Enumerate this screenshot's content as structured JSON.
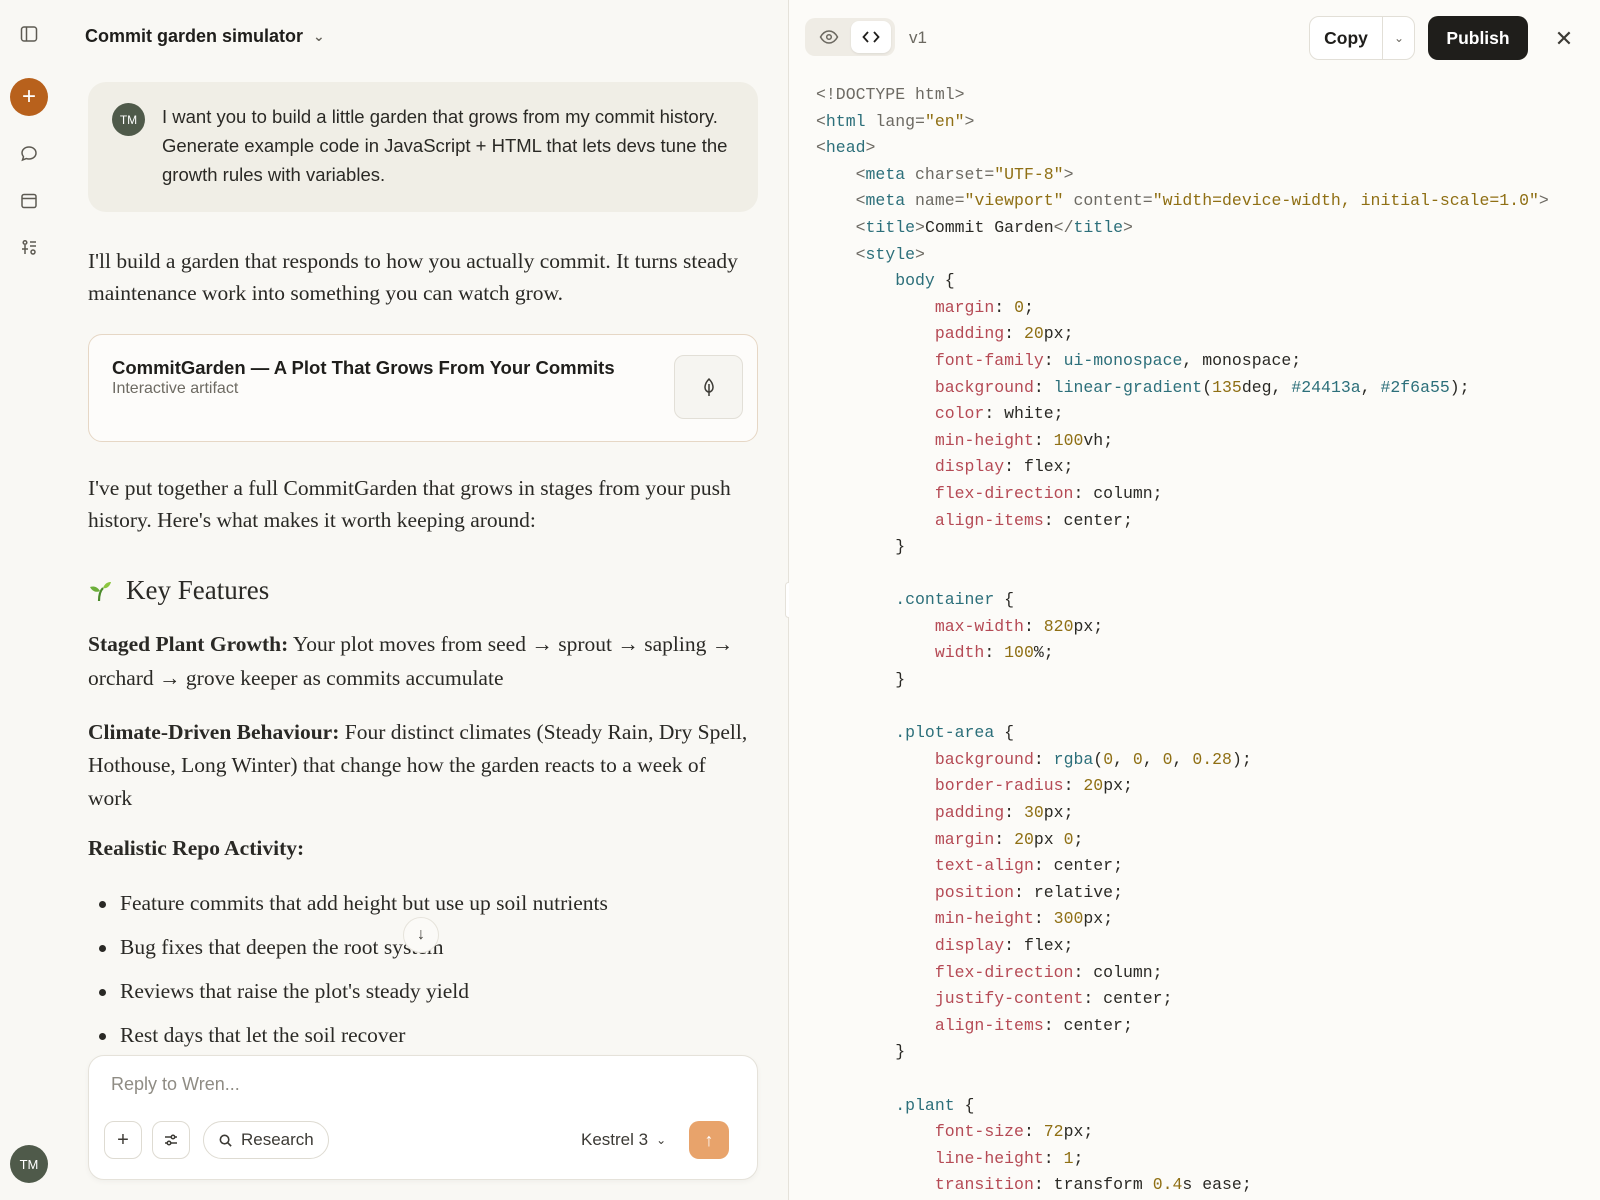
{
  "sidebar": {
    "avatar_initials": "TM",
    "new_chat_icon": "plus-icon",
    "items": [
      {
        "name": "sidebar-toggle-icon"
      },
      {
        "name": "chats-icon"
      },
      {
        "name": "projects-icon"
      },
      {
        "name": "artifacts-icon"
      }
    ]
  },
  "chat": {
    "title": "Commit garden simulator",
    "user_message": {
      "avatar": "TM",
      "text": "I want you to build a little garden that grows from my commit history. Generate example code in JavaScript + HTML that lets devs tune the growth rules with variables."
    },
    "intro": "I'll build a garden that responds to how you actually commit. It turns steady maintenance work into something you can watch grow.",
    "artifact": {
      "title": "CommitGarden — A Plot That Grows From Your Commits",
      "subtitle": "Interactive artifact"
    },
    "paragraph2": "I've put together a full CommitGarden that grows in stages from your push history. Here's what makes it worth keeping around:",
    "features_heading": "Key Features",
    "feature1": {
      "label": "Staged Plant Growth:",
      "text": " Your plot moves from seed → sprout → sapling → orchard → grove keeper as commits accumulate"
    },
    "feature2": {
      "label": "Climate-Driven Behaviour:",
      "text": " Four distinct climates (Steady Rain, Dry Spell, Hothouse, Long Winter) that change how the garden reacts to a week of work"
    },
    "feature3_label": "Realistic Repo Activity:",
    "bullets": [
      "Feature commits that add height but use up soil nutrients",
      "Bug fixes that deepen the root system",
      "Reviews that raise the plot's steady yield",
      "Rest days that let the soil recover"
    ]
  },
  "composer": {
    "placeholder": "Reply to Wren...",
    "research_label": "Research",
    "model": "Kestrel 3"
  },
  "panel": {
    "version": "v1",
    "copy_label": "Copy",
    "publish_label": "Publish",
    "code_lines": [
      [
        {
          "t": "<!DOCTYPE html>",
          "c": "k-attr"
        }
      ],
      [
        {
          "t": "<",
          "c": "k-attr"
        },
        {
          "t": "html",
          "c": "k-tag"
        },
        {
          "t": " lang=",
          "c": "k-attr"
        },
        {
          "t": "\"en\"",
          "c": "k-str"
        },
        {
          "t": ">",
          "c": "k-attr"
        }
      ],
      [
        {
          "t": "<",
          "c": "k-attr"
        },
        {
          "t": "head",
          "c": "k-tag"
        },
        {
          "t": ">",
          "c": "k-attr"
        }
      ],
      [
        {
          "t": "    <",
          "c": "k-attr"
        },
        {
          "t": "meta",
          "c": "k-tag"
        },
        {
          "t": " charset=",
          "c": "k-attr"
        },
        {
          "t": "\"UTF-8\"",
          "c": "k-str"
        },
        {
          "t": ">",
          "c": "k-attr"
        }
      ],
      [
        {
          "t": "    <",
          "c": "k-attr"
        },
        {
          "t": "meta",
          "c": "k-tag"
        },
        {
          "t": " name=",
          "c": "k-attr"
        },
        {
          "t": "\"viewport\"",
          "c": "k-str"
        },
        {
          "t": " content=",
          "c": "k-attr"
        },
        {
          "t": "\"width=device-width, initial-scale=1.0\"",
          "c": "k-str"
        },
        {
          "t": ">",
          "c": "k-attr"
        }
      ],
      [
        {
          "t": "    <",
          "c": "k-attr"
        },
        {
          "t": "title",
          "c": "k-tag"
        },
        {
          "t": ">",
          "c": "k-attr"
        },
        {
          "t": "Commit Garden",
          "c": ""
        },
        {
          "t": "</",
          "c": "k-attr"
        },
        {
          "t": "title",
          "c": "k-tag"
        },
        {
          "t": ">",
          "c": "k-attr"
        }
      ],
      [
        {
          "t": "    <",
          "c": "k-attr"
        },
        {
          "t": "style",
          "c": "k-tag"
        },
        {
          "t": ">",
          "c": "k-attr"
        }
      ],
      [
        {
          "t": "        ",
          "c": ""
        },
        {
          "t": "body",
          "c": "k-sel"
        },
        {
          "t": " {",
          "c": ""
        }
      ],
      [
        {
          "t": "            ",
          "c": ""
        },
        {
          "t": "margin",
          "c": "k-prop"
        },
        {
          "t": ": ",
          "c": ""
        },
        {
          "t": "0",
          "c": "k-num"
        },
        {
          "t": ";",
          "c": ""
        }
      ],
      [
        {
          "t": "            ",
          "c": ""
        },
        {
          "t": "padding",
          "c": "k-prop"
        },
        {
          "t": ": ",
          "c": ""
        },
        {
          "t": "20",
          "c": "k-num"
        },
        {
          "t": "px;",
          "c": ""
        }
      ],
      [
        {
          "t": "            ",
          "c": ""
        },
        {
          "t": "font-family",
          "c": "k-prop"
        },
        {
          "t": ": ",
          "c": ""
        },
        {
          "t": "ui-monospace",
          "c": "k-fn"
        },
        {
          "t": ", monospace;",
          "c": ""
        }
      ],
      [
        {
          "t": "            ",
          "c": ""
        },
        {
          "t": "background",
          "c": "k-prop"
        },
        {
          "t": ": ",
          "c": ""
        },
        {
          "t": "linear-gradient",
          "c": "k-fn"
        },
        {
          "t": "(",
          "c": ""
        },
        {
          "t": "135",
          "c": "k-num"
        },
        {
          "t": "deg, ",
          "c": ""
        },
        {
          "t": "#24413a",
          "c": "k-col"
        },
        {
          "t": ", ",
          "c": ""
        },
        {
          "t": "#2f6a55",
          "c": "k-col"
        },
        {
          "t": ");",
          "c": ""
        }
      ],
      [
        {
          "t": "            ",
          "c": ""
        },
        {
          "t": "color",
          "c": "k-prop"
        },
        {
          "t": ": white;",
          "c": ""
        }
      ],
      [
        {
          "t": "            ",
          "c": ""
        },
        {
          "t": "min-height",
          "c": "k-prop"
        },
        {
          "t": ": ",
          "c": ""
        },
        {
          "t": "100",
          "c": "k-num"
        },
        {
          "t": "vh;",
          "c": ""
        }
      ],
      [
        {
          "t": "            ",
          "c": ""
        },
        {
          "t": "display",
          "c": "k-prop"
        },
        {
          "t": ": flex;",
          "c": ""
        }
      ],
      [
        {
          "t": "            ",
          "c": ""
        },
        {
          "t": "flex-direction",
          "c": "k-prop"
        },
        {
          "t": ": column;",
          "c": ""
        }
      ],
      [
        {
          "t": "            ",
          "c": ""
        },
        {
          "t": "align-items",
          "c": "k-prop"
        },
        {
          "t": ": center;",
          "c": ""
        }
      ],
      [
        {
          "t": "        }",
          "c": ""
        }
      ],
      [
        {
          "t": "",
          "c": ""
        }
      ],
      [
        {
          "t": "        ",
          "c": ""
        },
        {
          "t": ".container",
          "c": "k-sel"
        },
        {
          "t": " {",
          "c": ""
        }
      ],
      [
        {
          "t": "            ",
          "c": ""
        },
        {
          "t": "max-width",
          "c": "k-prop"
        },
        {
          "t": ": ",
          "c": ""
        },
        {
          "t": "820",
          "c": "k-num"
        },
        {
          "t": "px;",
          "c": ""
        }
      ],
      [
        {
          "t": "            ",
          "c": ""
        },
        {
          "t": "width",
          "c": "k-prop"
        },
        {
          "t": ": ",
          "c": ""
        },
        {
          "t": "100",
          "c": "k-num"
        },
        {
          "t": "%;",
          "c": ""
        }
      ],
      [
        {
          "t": "        }",
          "c": ""
        }
      ],
      [
        {
          "t": "",
          "c": ""
        }
      ],
      [
        {
          "t": "        ",
          "c": ""
        },
        {
          "t": ".plot-area",
          "c": "k-sel"
        },
        {
          "t": " {",
          "c": ""
        }
      ],
      [
        {
          "t": "            ",
          "c": ""
        },
        {
          "t": "background",
          "c": "k-prop"
        },
        {
          "t": ": ",
          "c": ""
        },
        {
          "t": "rgba",
          "c": "k-fn"
        },
        {
          "t": "(",
          "c": ""
        },
        {
          "t": "0",
          "c": "k-num"
        },
        {
          "t": ", ",
          "c": ""
        },
        {
          "t": "0",
          "c": "k-num"
        },
        {
          "t": ", ",
          "c": ""
        },
        {
          "t": "0",
          "c": "k-num"
        },
        {
          "t": ", ",
          "c": ""
        },
        {
          "t": "0.28",
          "c": "k-num"
        },
        {
          "t": ");",
          "c": ""
        }
      ],
      [
        {
          "t": "            ",
          "c": ""
        },
        {
          "t": "border-radius",
          "c": "k-prop"
        },
        {
          "t": ": ",
          "c": ""
        },
        {
          "t": "20",
          "c": "k-num"
        },
        {
          "t": "px;",
          "c": ""
        }
      ],
      [
        {
          "t": "            ",
          "c": ""
        },
        {
          "t": "padding",
          "c": "k-prop"
        },
        {
          "t": ": ",
          "c": ""
        },
        {
          "t": "30",
          "c": "k-num"
        },
        {
          "t": "px;",
          "c": ""
        }
      ],
      [
        {
          "t": "            ",
          "c": ""
        },
        {
          "t": "margin",
          "c": "k-prop"
        },
        {
          "t": ": ",
          "c": ""
        },
        {
          "t": "20",
          "c": "k-num"
        },
        {
          "t": "px ",
          "c": ""
        },
        {
          "t": "0",
          "c": "k-num"
        },
        {
          "t": ";",
          "c": ""
        }
      ],
      [
        {
          "t": "            ",
          "c": ""
        },
        {
          "t": "text-align",
          "c": "k-prop"
        },
        {
          "t": ": center;",
          "c": ""
        }
      ],
      [
        {
          "t": "            ",
          "c": ""
        },
        {
          "t": "position",
          "c": "k-prop"
        },
        {
          "t": ": relative;",
          "c": ""
        }
      ],
      [
        {
          "t": "            ",
          "c": ""
        },
        {
          "t": "min-height",
          "c": "k-prop"
        },
        {
          "t": ": ",
          "c": ""
        },
        {
          "t": "300",
          "c": "k-num"
        },
        {
          "t": "px;",
          "c": ""
        }
      ],
      [
        {
          "t": "            ",
          "c": ""
        },
        {
          "t": "display",
          "c": "k-prop"
        },
        {
          "t": ": flex;",
          "c": ""
        }
      ],
      [
        {
          "t": "            ",
          "c": ""
        },
        {
          "t": "flex-direction",
          "c": "k-prop"
        },
        {
          "t": ": column;",
          "c": ""
        }
      ],
      [
        {
          "t": "            ",
          "c": ""
        },
        {
          "t": "justify-content",
          "c": "k-prop"
        },
        {
          "t": ": center;",
          "c": ""
        }
      ],
      [
        {
          "t": "            ",
          "c": ""
        },
        {
          "t": "align-items",
          "c": "k-prop"
        },
        {
          "t": ": center;",
          "c": ""
        }
      ],
      [
        {
          "t": "        }",
          "c": ""
        }
      ],
      [
        {
          "t": "",
          "c": ""
        }
      ],
      [
        {
          "t": "        ",
          "c": ""
        },
        {
          "t": ".plant",
          "c": "k-sel"
        },
        {
          "t": " {",
          "c": ""
        }
      ],
      [
        {
          "t": "            ",
          "c": ""
        },
        {
          "t": "font-size",
          "c": "k-prop"
        },
        {
          "t": ": ",
          "c": ""
        },
        {
          "t": "72",
          "c": "k-num"
        },
        {
          "t": "px;",
          "c": ""
        }
      ],
      [
        {
          "t": "            ",
          "c": ""
        },
        {
          "t": "line-height",
          "c": "k-prop"
        },
        {
          "t": ": ",
          "c": ""
        },
        {
          "t": "1",
          "c": "k-num"
        },
        {
          "t": ";",
          "c": ""
        }
      ],
      [
        {
          "t": "            ",
          "c": ""
        },
        {
          "t": "transition",
          "c": "k-prop"
        },
        {
          "t": ": transform ",
          "c": ""
        },
        {
          "t": "0.4",
          "c": "k-num"
        },
        {
          "t": "s ease;",
          "c": ""
        }
      ]
    ]
  }
}
